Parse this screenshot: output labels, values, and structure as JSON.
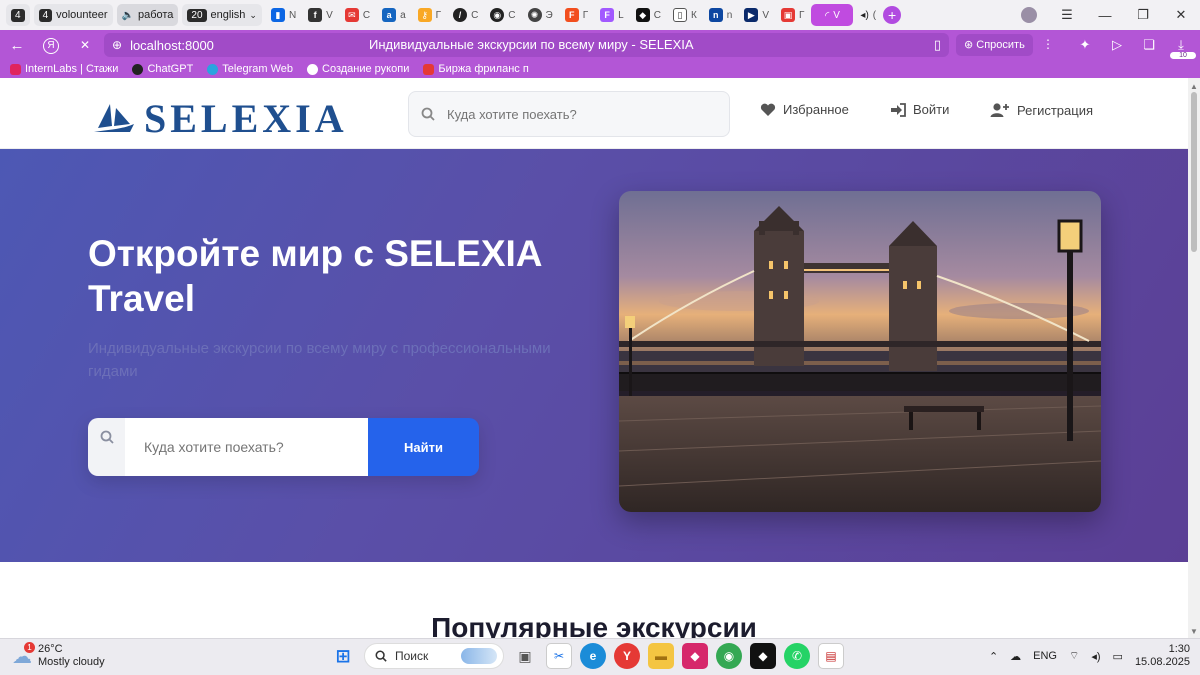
{
  "browser": {
    "tabs": [
      {
        "num": "4",
        "label": ""
      },
      {
        "num": "4",
        "label": "volounteer"
      },
      {
        "num": "",
        "label": "работа"
      },
      {
        "num": "20",
        "label": "english"
      }
    ],
    "pinned_tab_letters": [
      "N",
      "V",
      "C",
      "a",
      "Г",
      "С",
      "С",
      "Э",
      "Г",
      "L",
      "С",
      "К",
      "n",
      "V",
      "Г",
      "V",
      "("
    ],
    "url": "localhost:8000",
    "page_title": "Индивидуальные экскурсии по всему миру - SELEXIA",
    "ask_label": "Спросить",
    "downloads_badge": "10",
    "bookmarks": [
      {
        "label": "InternLabs | Стажи",
        "color": "#e0245e"
      },
      {
        "label": "ChatGPT",
        "color": "#222222"
      },
      {
        "label": "Telegram Web",
        "color": "#2aa3df"
      },
      {
        "label": "Создание рукопи",
        "color": "#ffffff"
      },
      {
        "label": "Биржа фриланс п",
        "color": "#e53935"
      }
    ]
  },
  "site": {
    "brand": "SELEXIA",
    "header_search_placeholder": "Куда хотите поехать?",
    "nav": {
      "favorites": "Избранное",
      "login": "Войти",
      "register": "Регистрация"
    },
    "hero": {
      "title": "Откройте мир с SELEXIA Travel",
      "subtitle": "Индивидуальные экскурсии по всему миру с профессиональными гидами",
      "search_placeholder": "Куда хотите поехать?",
      "search_button": "Найти"
    },
    "section_title": "Популярные экскурсии"
  },
  "taskbar": {
    "weather_temp": "26°C",
    "weather_desc": "Mostly cloudy",
    "weather_badge": "1",
    "search_label": "Поиск",
    "lang": "ENG",
    "time": "1:30",
    "date": "15.08.2025"
  },
  "colors": {
    "browser_accent": "#b356d6",
    "brand_blue": "#1f4f8f",
    "hero_gradient_start": "#4d58b4",
    "hero_gradient_end": "#5b3f95",
    "search_button": "#2563eb"
  }
}
